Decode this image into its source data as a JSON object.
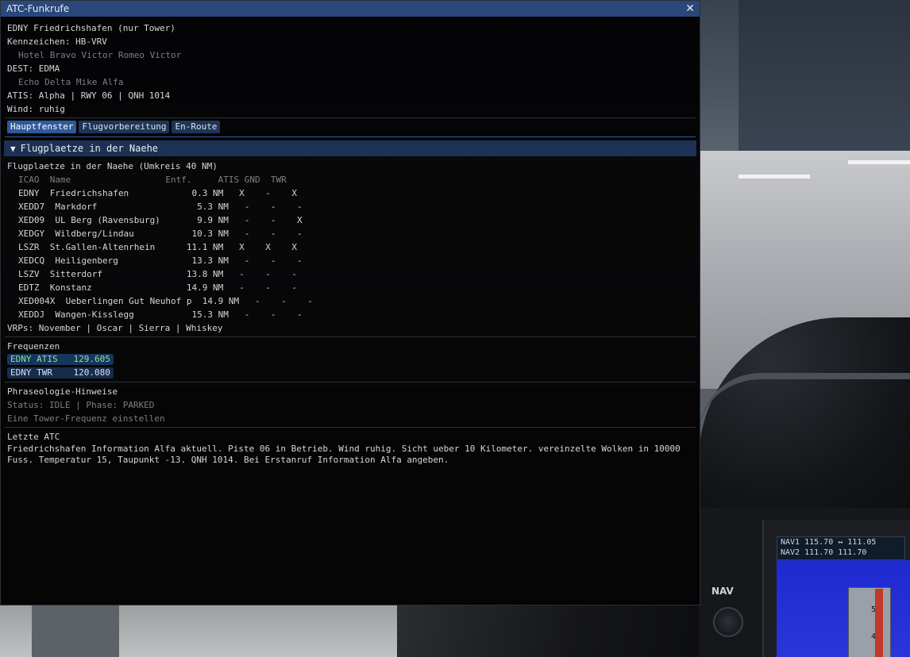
{
  "window": {
    "title": "ATC-Funkrufe"
  },
  "header": {
    "station": "EDNY Friedrichshafen (nur Tower)",
    "callsign": "Kennzeichen: HB-VRV",
    "callsign_phonetic": "Hotel Bravo Victor Romeo Victor",
    "dest": "DEST: EDMA",
    "dest_phonetic": "Echo Delta Mike Alfa",
    "atis": "ATIS: Alpha | RWY 06 | QNH 1014",
    "wind": "Wind: ruhig"
  },
  "tabs": [
    {
      "label": "Hauptfenster",
      "active": true
    },
    {
      "label": "Flugvorbereitung",
      "active": false
    },
    {
      "label": "En-Route",
      "active": false
    }
  ],
  "nearby": {
    "header": "Flugplaetze in der Naehe",
    "subtitle": "Flugplaetze in der Naehe (Umkreis 40 NM)",
    "columns_line": "ICAO  Name                  Entf.     ATIS GND  TWR",
    "rows": [
      "EDNY  Friedrichshafen            0.3 NM   X    -    X",
      "XEDD7  Markdorf                   5.3 NM   -    -    -",
      "XED09  UL Berg (Ravensburg)       9.9 NM   -    -    X",
      "XEDGY  Wildberg/Lindau           10.3 NM   -    -    -",
      "LSZR  St.Gallen-Altenrhein      11.1 NM   X    X    X",
      "XEDCQ  Heiligenberg              13.3 NM   -    -    -",
      "LSZV  Sitterdorf                13.8 NM   -    -    -",
      "EDTZ  Konstanz                  14.9 NM   -    -    -",
      "XED004X  Ueberlingen Gut Neuhof p  14.9 NM   -    -    -",
      "XEDDJ  Wangen-Kisslegg           15.3 NM   -    -    -"
    ],
    "vrps": "VRPs: November | Oscar | Sierra | Whiskey"
  },
  "frequencies": {
    "title": "Frequenzen",
    "items": [
      {
        "label": "EDNY ATIS   129.605",
        "active": true
      },
      {
        "label": "EDNY TWR    120.080",
        "active": false
      }
    ]
  },
  "phraseology": {
    "title": "Phraseologie-Hinweise",
    "status": "Status: IDLE | Phase: PARKED",
    "hint": "Eine Tower-Frequenz einstellen"
  },
  "last_atc": {
    "title": "Letzte ATC",
    "text": "Friedrichshafen Information Alfa aktuell. Piste 06 in Betrieb. Wind ruhig. Sicht ueber 10 Kilometer. vereinzelte Wolken in 10000 Fuss. Temperatur 15, Taupunkt -13. QNH 1014. Bei Erstanruf Information Alfa angeben."
  },
  "cockpit": {
    "nav_label": "NAV",
    "radio_line1": "NAV1 115.70  ↔ 111.05",
    "radio_line2": "NAV2 111.70    111.70",
    "tape_marks": [
      "50",
      "40"
    ]
  }
}
